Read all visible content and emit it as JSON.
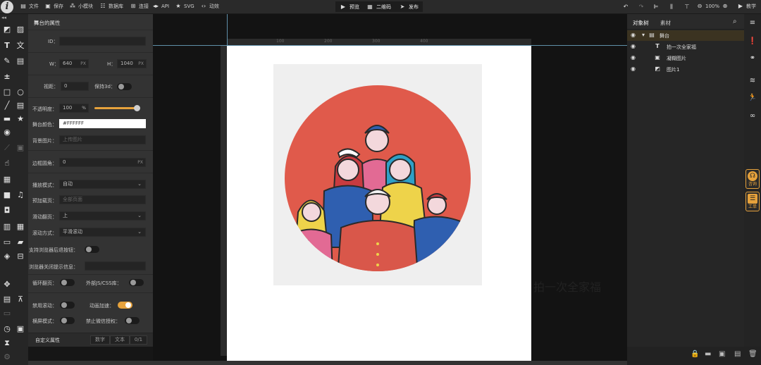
{
  "topbar": {
    "logo": "i",
    "file_label": "文件",
    "save_label": "保存",
    "module_label": "小模块",
    "database_label": "数据库",
    "connect_label": "连接",
    "api_label": "API",
    "svg_label": "SVG",
    "anim_label": "动效",
    "preview_label": "预览",
    "qrcode_label": "二维码",
    "publish_label": "发布",
    "zoom": "100%",
    "tutorial_label": "教学",
    "icons": [
      "file-icon",
      "save-icon",
      "module-icon",
      "database-icon",
      "connect-icon",
      "api-icon",
      "star-icon",
      "anim-icon",
      "play-icon",
      "qrcode-icon",
      "send-icon",
      "undo-icon",
      "redo-icon",
      "align-left-icon",
      "align-center-icon",
      "align-top-icon",
      "align-middle-icon",
      "zoom-out-icon",
      "zoom-in-icon",
      "video-icon"
    ]
  },
  "iconstrip": {
    "collapse_label": "◂◂",
    "icons": [
      "image-edit-icon",
      "image-frame-icon",
      "text-icon",
      "translate-icon",
      "edit-icon",
      "list-icon",
      "counter-icon",
      "rect-icon",
      "circle-icon",
      "line-icon",
      "doc-icon",
      "folder-icon",
      "star-icon",
      "play-circle-icon",
      "brush-icon",
      "gallery-icon",
      "touch-icon",
      "qr-icon",
      "video-icon",
      "music-icon",
      "vote-icon",
      "copy-icon",
      "paste-icon",
      "screen-icon",
      "folder-open-icon",
      "layers-stack-icon",
      "frame-icon",
      "move-icon",
      "table-icon",
      "easel-icon",
      "monitor-icon",
      "timer-icon",
      "hourglass-icon",
      "gear-icon"
    ]
  },
  "props": {
    "title": "舞台的属性",
    "id_label": "ID：",
    "id_value": "",
    "w_label": "W：",
    "w_value": "640",
    "h_label": "H：",
    "h_value": "1040",
    "px": "PX",
    "perspective_label": "视距：",
    "perspective_value": "0",
    "keep3d_label": "保持3d：",
    "opacity_label": "不透明度：",
    "opacity_value": "100",
    "opacity_unit": "%",
    "opacity_fraction": 1.0,
    "stage_color_label": "舞台颜色：",
    "stage_color_value": "#FFFFFF",
    "bg_image_label": "背景图片：",
    "bg_image_placeholder": "上传图片",
    "radius_label": "边框圆角：",
    "radius_value": "0",
    "play_mode_label": "播放模式：",
    "play_mode_value": "自动",
    "preload_label": "预加载页：",
    "preload_placeholder": "全部页面",
    "swipe_label": "滑动翻页：",
    "swipe_value": "上",
    "scroll_mode_label": "滚动方式：",
    "scroll_mode_value": "平滑滚动",
    "back_btn_label": "支持浏览器后退按钮：",
    "close_tip_label": "浏览器关闭提示信息：",
    "close_tip_value": "",
    "loop_label": "循环翻页：",
    "external_label": "外部JS/CSS库：",
    "disable_scroll_label": "禁用滚动：",
    "anim_accel_label": "动画加速：",
    "landscape_label": "横屏模式：",
    "disable_wechat_label": "禁止微信授权：",
    "custom_label": "自定义属性",
    "custom_tab_number": "数字",
    "custom_tab_text": "文本",
    "custom_count": "0/1",
    "toggles": {
      "keep3d": false,
      "back_btn": false,
      "loop": false,
      "external": false,
      "disable_scroll": false,
      "anim_accel": true,
      "landscape": false,
      "disable_wechat": false
    }
  },
  "canvas": {
    "ruler_ticks": [
      "100",
      "200",
      "300",
      "400"
    ],
    "vruler_ticks": [
      "100",
      "200",
      "300",
      "400",
      "500"
    ],
    "caption": "拍一次全家福",
    "colors": {
      "circle": "#e05a4b",
      "placeholder_bg": "#efefef",
      "stage": "#ffffff"
    }
  },
  "layers": {
    "tab_objects": "对象树",
    "tab_assets": "素材",
    "items": [
      {
        "name": "舞台",
        "icon": "stage-icon"
      },
      {
        "name": "拍一次全家福",
        "icon": "text-icon"
      },
      {
        "name": "凝糊图片",
        "icon": "image-icon"
      },
      {
        "name": "图片1",
        "icon": "image-icon"
      }
    ]
  },
  "rstrip": {
    "icons": [
      "menu-icon",
      "alert-icon",
      "link-chain-icon",
      "filter-icon",
      "run-icon",
      "chain-icon",
      "trash-icon"
    ],
    "help_label": "咨询",
    "ticket_label": "工单"
  }
}
